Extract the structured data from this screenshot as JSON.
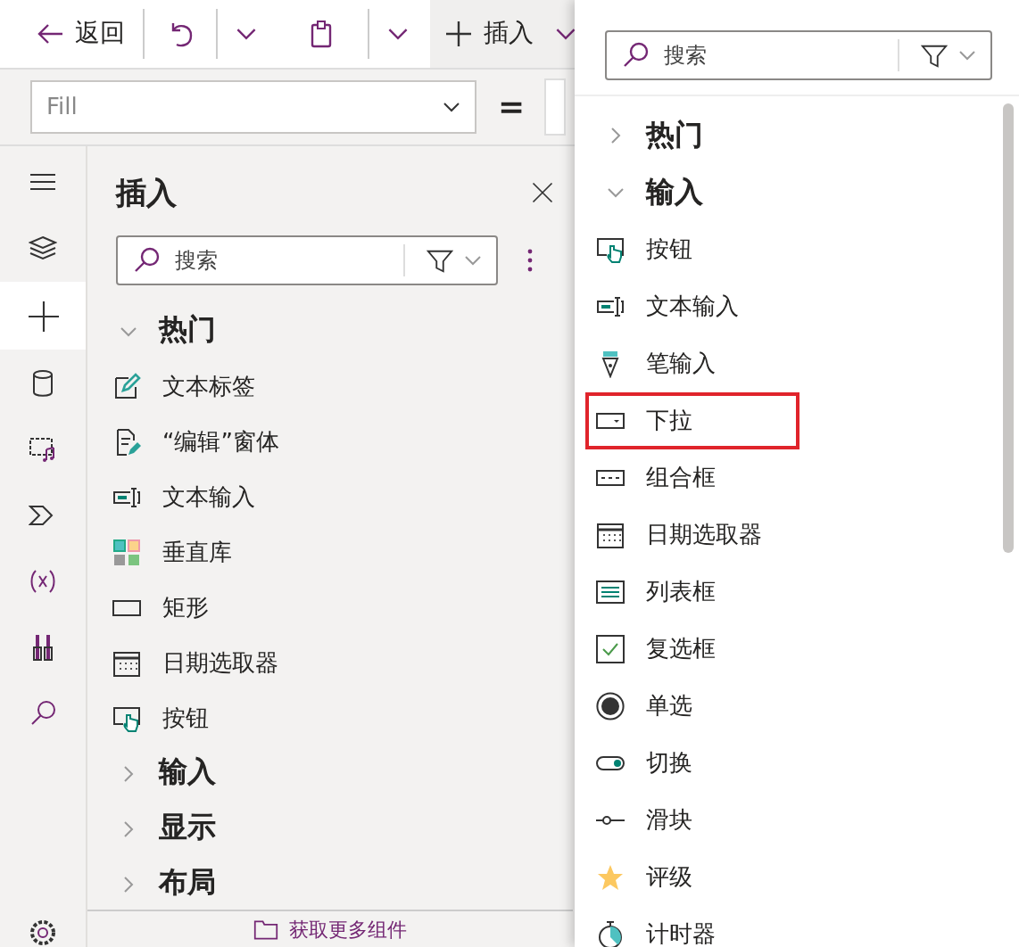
{
  "toolbar": {
    "back_label": "返回",
    "insert_label": "插入"
  },
  "formula_bar": {
    "property": "Fill",
    "operator": "="
  },
  "insert_panel": {
    "title": "插入",
    "search": {
      "placeholder": "搜索"
    },
    "groups": [
      {
        "label": "热门",
        "expanded": true,
        "items": [
          {
            "label": "文本标签",
            "kind": "label"
          },
          {
            "label": "“编辑”窗体",
            "kind": "form"
          },
          {
            "label": "文本输入",
            "kind": "text-input"
          },
          {
            "label": "垂直库",
            "kind": "gallery"
          },
          {
            "label": "矩形",
            "kind": "rectangle"
          },
          {
            "label": "日期选取器",
            "kind": "date-picker"
          },
          {
            "label": "按钮",
            "kind": "button"
          }
        ]
      },
      {
        "label": "输入",
        "expanded": false
      },
      {
        "label": "显示",
        "expanded": false
      },
      {
        "label": "布局",
        "expanded": false
      }
    ],
    "footer_link": "获取更多组件"
  },
  "flyout": {
    "search": {
      "placeholder": "搜索"
    },
    "groups": [
      {
        "label": "热门",
        "expanded": false
      },
      {
        "label": "输入",
        "expanded": true,
        "items": [
          {
            "label": "按钮",
            "kind": "button",
            "highlighted": false
          },
          {
            "label": "文本输入",
            "kind": "text-input",
            "highlighted": false
          },
          {
            "label": "笔输入",
            "kind": "pen",
            "highlighted": false
          },
          {
            "label": "下拉",
            "kind": "dropdown",
            "highlighted": true
          },
          {
            "label": "组合框",
            "kind": "combo-box",
            "highlighted": false
          },
          {
            "label": "日期选取器",
            "kind": "date-picker",
            "highlighted": false
          },
          {
            "label": "列表框",
            "kind": "list-box",
            "highlighted": false
          },
          {
            "label": "复选框",
            "kind": "checkbox",
            "highlighted": false
          },
          {
            "label": "单选",
            "kind": "radio",
            "highlighted": false
          },
          {
            "label": "切换",
            "kind": "toggle",
            "highlighted": false
          },
          {
            "label": "滑块",
            "kind": "slider",
            "highlighted": false
          },
          {
            "label": "评级",
            "kind": "rating",
            "highlighted": false
          },
          {
            "label": "计时器",
            "kind": "timer",
            "highlighted": false
          }
        ]
      }
    ]
  }
}
